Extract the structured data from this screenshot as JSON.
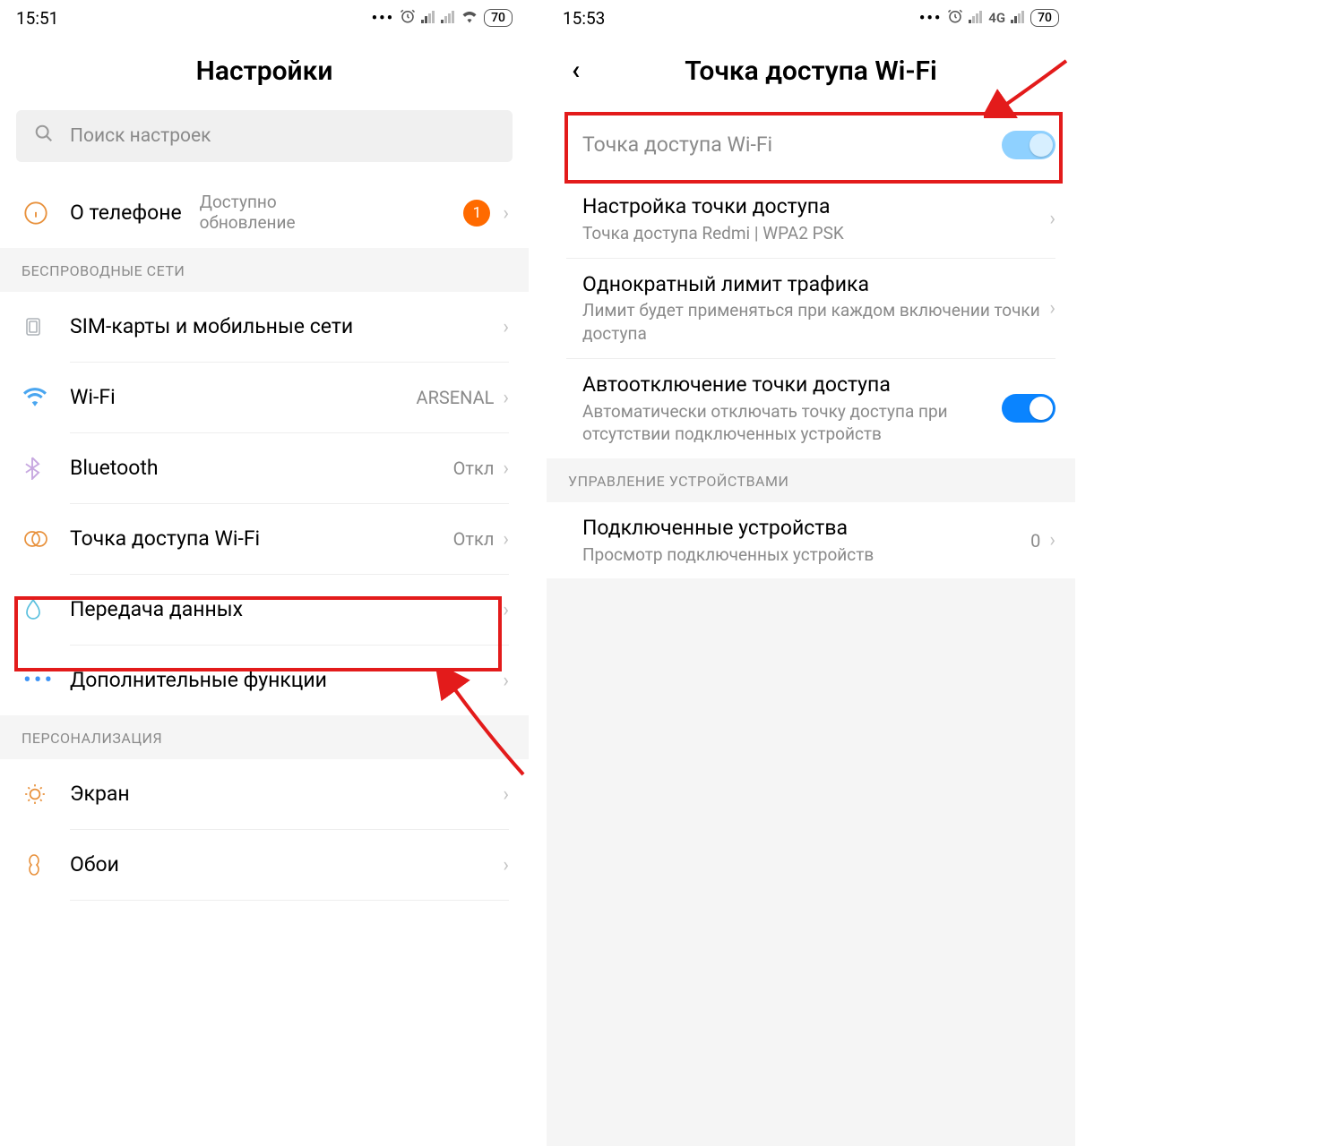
{
  "left": {
    "status": {
      "time": "15:51",
      "battery": "70"
    },
    "title": "Настройки",
    "search_placeholder": "Поиск настроек",
    "about": {
      "label": "О телефоне",
      "sub1": "Доступно",
      "sub2": "обновление",
      "badge": "1"
    },
    "section_wireless": "БЕСПРОВОДНЫЕ СЕТИ",
    "items": {
      "sim": "SIM-карты и мобильные сети",
      "wifi": "Wi-Fi",
      "wifi_value": "ARSENAL",
      "bluetooth": "Bluetooth",
      "bluetooth_value": "Откл",
      "hotspot": "Точка доступа Wi-Fi",
      "hotspot_value": "Откл",
      "data": "Передача данных",
      "more": "Дополнительные функции"
    },
    "section_personal": "ПЕРСОНАЛИЗАЦИЯ",
    "display": "Экран",
    "wallpaper": "Обои"
  },
  "right": {
    "status": {
      "time": "15:53",
      "net": "4G",
      "battery": "70"
    },
    "title": "Точка доступа Wi-Fi",
    "toggle_label": "Точка доступа Wi-Fi",
    "setup": {
      "title": "Настройка точки доступа",
      "sub": "Точка доступа Redmi | WPA2 PSK"
    },
    "limit": {
      "title": "Однократный лимит трафика",
      "sub": "Лимит будет применяться при каждом включении точки доступа"
    },
    "auto_off": {
      "title": "Автоотключение точки доступа",
      "sub": "Автоматически отключать точку доступа при отсутствии подключенных устройств"
    },
    "section_devices": "УПРАВЛЕНИЕ УСТРОЙСТВАМИ",
    "devices": {
      "title": "Подключенные устройства",
      "sub": "Просмотр подключенных устройств",
      "count": "0"
    }
  }
}
